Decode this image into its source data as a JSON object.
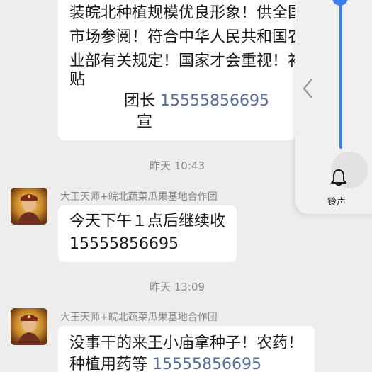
{
  "messages": [
    {
      "lines": [
        "装皖北种植规模优良形象！供全国",
        "市场参阅！符合中华人民共和国农",
        "业部有关规定！国家才会重视！补",
        "贴"
      ],
      "signature": "团长",
      "signature_phone": "15555856695",
      "signature_tail": "宣"
    },
    {
      "sender": "大王天师+皖北蔬菜瓜果基地合作团",
      "text": "今天下午１点后继续收",
      "phone": "15555856695"
    },
    {
      "sender": "大王天师+皖北蔬菜瓜果基地合作团",
      "text": "没事干的来王小庙拿种子！农药！",
      "text2": "种植用药等",
      "phone": "15555856695"
    }
  ],
  "timestamps": [
    "昨天 10:43",
    "昨天 13:09"
  ],
  "side_panel": {
    "ringtone_label": "铃声",
    "volume_level_fraction": 1.0,
    "icons": [
      "chevron-left-icon",
      "bell-icon"
    ]
  },
  "colors": {
    "background": "#ededed",
    "bubble": "#ffffff",
    "phone_link": "#576b95",
    "slider": "#3c7cf0"
  }
}
